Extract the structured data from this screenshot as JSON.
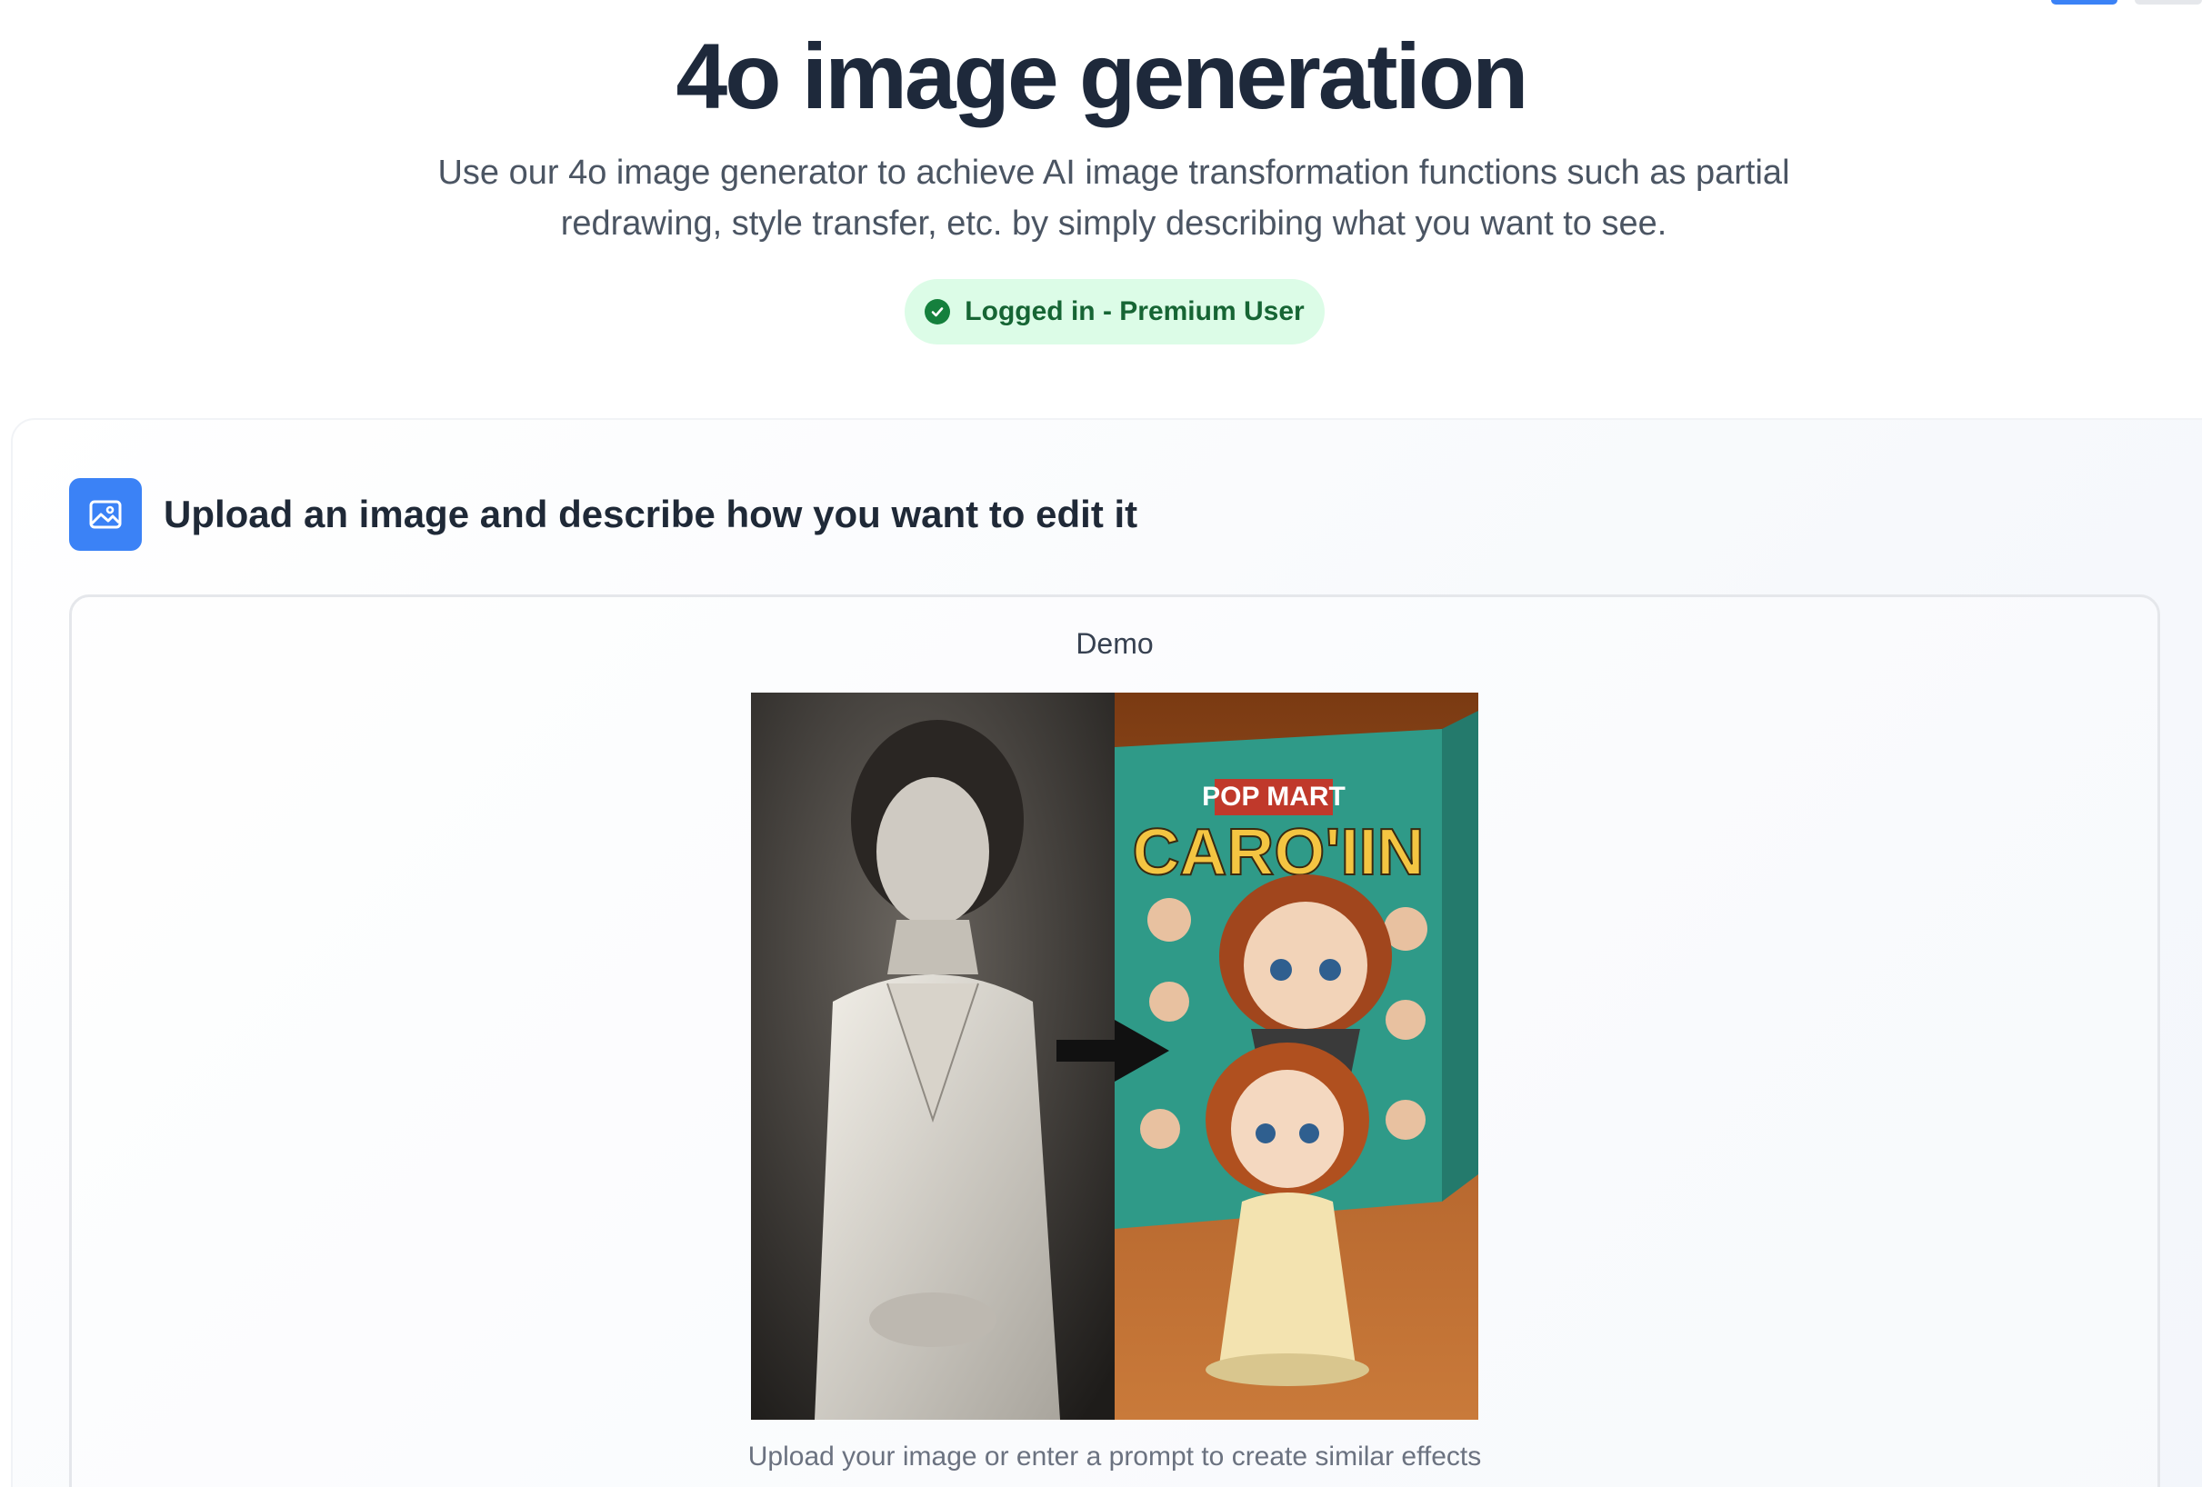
{
  "hero": {
    "title": "4o image generation",
    "subtitle": "Use our 4o image generator to achieve AI image transformation functions such as partial redrawing, style transfer, etc. by simply describing what you want to see.",
    "status": "Logged in - Premium User"
  },
  "editor": {
    "heading": "Upload an image and describe how you want to edit it",
    "demo_label": "Demo",
    "demo_box_text": "POP MART",
    "demo_box_title": "CARO'IIN",
    "caption": "Upload your image or enter a prompt to create similar effects"
  },
  "colors": {
    "accent": "#3b82f6",
    "status_bg": "#dcfce7",
    "status_text": "#166534"
  },
  "icons": {
    "status": "check-circle-icon",
    "editor": "image-icon",
    "demo_arrow": "arrow-right-icon"
  }
}
